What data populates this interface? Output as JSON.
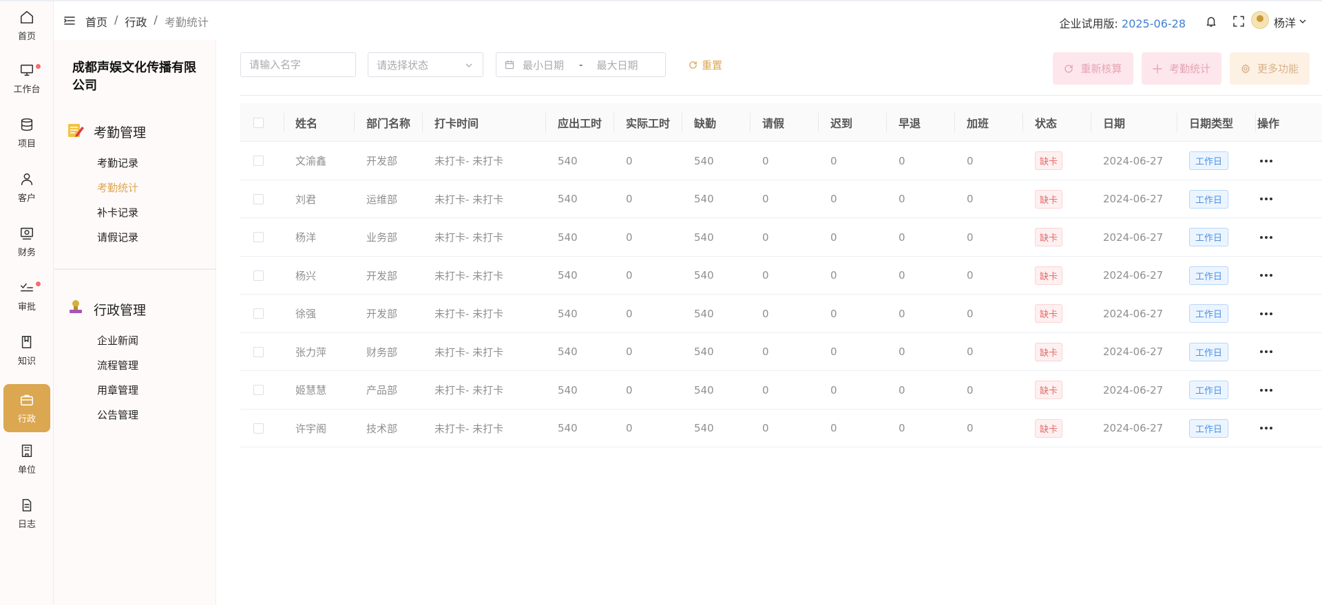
{
  "rail": {
    "items": [
      {
        "label": "首页",
        "icon": "home-icon"
      },
      {
        "label": "工作台",
        "icon": "monitor-icon"
      },
      {
        "label": "项目",
        "icon": "database-icon"
      },
      {
        "label": "客户",
        "icon": "user-icon"
      },
      {
        "label": "财务",
        "icon": "finance-icon"
      },
      {
        "label": "审批",
        "icon": "approve-icon"
      },
      {
        "label": "知识",
        "icon": "book-icon"
      },
      {
        "label": "行政",
        "icon": "briefcase-icon"
      },
      {
        "label": "单位",
        "icon": "building-icon"
      },
      {
        "label": "日志",
        "icon": "log-icon"
      }
    ]
  },
  "sidebar": {
    "company": "成都声娱文化传播有限公司",
    "groups": [
      {
        "title": "考勤管理",
        "icon": "attendance-icon",
        "items": [
          "考勤记录",
          "考勤统计",
          "补卡记录",
          "请假记录"
        ]
      },
      {
        "title": "行政管理",
        "icon": "admin-stamp-icon",
        "items": [
          "企业新闻",
          "流程管理",
          "用章管理",
          "公告管理"
        ]
      }
    ]
  },
  "header": {
    "breadcrumb": [
      "首页",
      "行政",
      "考勤统计"
    ],
    "trial_label": "企业试用版:",
    "trial_date": "2025-06-28",
    "username": "杨洋"
  },
  "filters": {
    "name_placeholder": "请输入名字",
    "status_placeholder": "请选择状态",
    "date_min_placeholder": "最小日期",
    "date_separator": "-",
    "date_max_placeholder": "最大日期",
    "reset_label": "重置"
  },
  "actions": {
    "recheck_label": "重新核算",
    "stats_label": "考勤统计",
    "more_label": "更多功能"
  },
  "table": {
    "columns": [
      "姓名",
      "部门名称",
      "打卡时间",
      "应出工时",
      "实际工时",
      "缺勤",
      "请假",
      "迟到",
      "早退",
      "加班",
      "状态",
      "日期",
      "日期类型",
      "操作"
    ],
    "rows": [
      {
        "name": "文渝鑫",
        "dept": "开发部",
        "clock": "未打卡- 未打卡",
        "due": "540",
        "actual": "0",
        "absent": "540",
        "leave": "0",
        "late": "0",
        "early": "0",
        "overtime": "0",
        "status": "缺卡",
        "date": "2024-06-27",
        "date_type": "工作日"
      },
      {
        "name": "刘君",
        "dept": "运维部",
        "clock": "未打卡- 未打卡",
        "due": "540",
        "actual": "0",
        "absent": "540",
        "leave": "0",
        "late": "0",
        "early": "0",
        "overtime": "0",
        "status": "缺卡",
        "date": "2024-06-27",
        "date_type": "工作日"
      },
      {
        "name": "杨洋",
        "dept": "业务部",
        "clock": "未打卡- 未打卡",
        "due": "540",
        "actual": "0",
        "absent": "540",
        "leave": "0",
        "late": "0",
        "early": "0",
        "overtime": "0",
        "status": "缺卡",
        "date": "2024-06-27",
        "date_type": "工作日"
      },
      {
        "name": "杨兴",
        "dept": "开发部",
        "clock": "未打卡- 未打卡",
        "due": "540",
        "actual": "0",
        "absent": "540",
        "leave": "0",
        "late": "0",
        "early": "0",
        "overtime": "0",
        "status": "缺卡",
        "date": "2024-06-27",
        "date_type": "工作日"
      },
      {
        "name": "徐强",
        "dept": "开发部",
        "clock": "未打卡- 未打卡",
        "due": "540",
        "actual": "0",
        "absent": "540",
        "leave": "0",
        "late": "0",
        "early": "0",
        "overtime": "0",
        "status": "缺卡",
        "date": "2024-06-27",
        "date_type": "工作日"
      },
      {
        "name": "张力萍",
        "dept": "财务部",
        "clock": "未打卡- 未打卡",
        "due": "540",
        "actual": "0",
        "absent": "540",
        "leave": "0",
        "late": "0",
        "early": "0",
        "overtime": "0",
        "status": "缺卡",
        "date": "2024-06-27",
        "date_type": "工作日"
      },
      {
        "name": "姬慧慧",
        "dept": "产品部",
        "clock": "未打卡- 未打卡",
        "due": "540",
        "actual": "0",
        "absent": "540",
        "leave": "0",
        "late": "0",
        "early": "0",
        "overtime": "0",
        "status": "缺卡",
        "date": "2024-06-27",
        "date_type": "工作日"
      },
      {
        "name": "许宇阁",
        "dept": "技术部",
        "clock": "未打卡- 未打卡",
        "due": "540",
        "actual": "0",
        "absent": "540",
        "leave": "0",
        "late": "0",
        "early": "0",
        "overtime": "0",
        "status": "缺卡",
        "date": "2024-06-27",
        "date_type": "工作日"
      }
    ]
  },
  "colors": {
    "accent": "#dba751",
    "link_blue": "#3f7fd1",
    "badge_red": "#e26b6b",
    "badge_blue": "#4a90e2",
    "notify_dot": "#f56c6c"
  }
}
